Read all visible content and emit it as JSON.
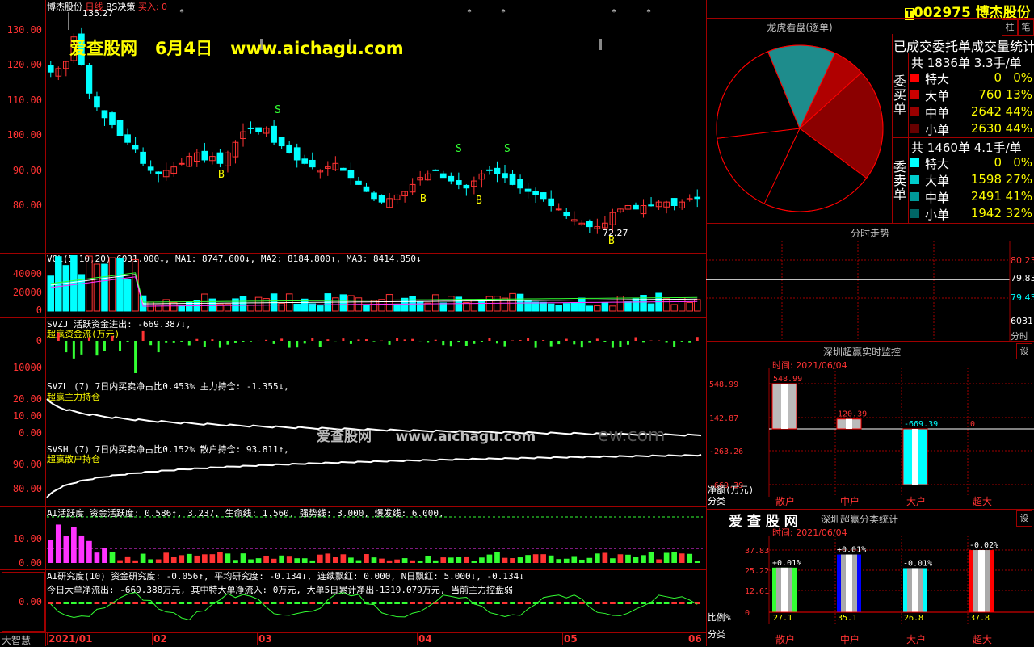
{
  "stock": {
    "code": "002975",
    "name": "博杰股份",
    "marker": "T",
    "header_left_name": "博杰股份",
    "period": "日线",
    "strategy": "BS决策",
    "buy_label": "买入: 0"
  },
  "watermark": {
    "banner": "爱查股网   6月4日   www.aichagu.com",
    "center": "爱查股网     www.aichagu.com",
    "ghost": "ew.com"
  },
  "main_chart": {
    "y_ticks": [
      "130.00",
      "120.00",
      "110.00",
      "100.00",
      "90.00",
      "80.00"
    ],
    "high_label": "135.27",
    "low_label": "72.27",
    "signals": [
      "S",
      "S",
      "S",
      "B",
      "B",
      "B",
      "B"
    ]
  },
  "vol": {
    "title": "VOL(5,10,20) 6031.000↓, MA1: 8747.600↓, MA2: 8184.800↑, MA3: 8414.850↓",
    "y_ticks": [
      "40000",
      "20000",
      "0"
    ]
  },
  "svzj": {
    "title": "SVZJ  活跃资金进出: -669.387↓,",
    "subtitle": "超赢资金流(万元)",
    "y_ticks": [
      "0",
      "-10000"
    ]
  },
  "svzl": {
    "title": "SVZL (7) 7日内买卖净占比0.453% 主力持仓: -1.355↓,",
    "subtitle": "超赢主力持仓",
    "y_ticks": [
      "20.00",
      "10.00",
      "0.00"
    ]
  },
  "svsh": {
    "title": "SVSH (7) 7日内买卖净占比0.152% 散户持仓: 93.811↑,",
    "subtitle": "超赢散户持仓",
    "y_ticks": [
      "90.00",
      "80.00"
    ]
  },
  "ai_active": {
    "title": "AI活跃度  资金活跃度: 0.586↑, 3.237, 生命线: 1.560, 强势线: 3.000, 爆发线: 6.000,",
    "y_ticks": [
      "10.00",
      "0.00"
    ]
  },
  "ai_research": {
    "title": "AI研究度(10)  资金研究度: -0.056↑, 平均研究度: -0.134↓, 连续飘红: 0.000, N日飘红: 5.000↓, -0.134↓",
    "line2": "今日大单净流出: -669.388万元, 其中特大单净流入: 0万元, 大单5日累计净出-1319.079万元, 当前主力控盘弱",
    "y_ticks": [
      "0.00"
    ]
  },
  "x_axis": {
    "labels": [
      "2021/01",
      "02",
      "03",
      "04",
      "05",
      "06"
    ]
  },
  "bottom_left": "大智慧",
  "tabs": {
    "col": "柱",
    "pen": "笔"
  },
  "dragon": {
    "title": "龙虎看盘(逐单)",
    "stat_title": "已成交委托单成交量统计",
    "buy": {
      "label": "委买单",
      "total": "共 1836单 3.3手/单",
      "rows": [
        {
          "name": "特大",
          "count": "0",
          "pct": "0%",
          "color": "#ff0000"
        },
        {
          "name": "大单",
          "count": "760",
          "pct": "13%",
          "color": "#cc0000"
        },
        {
          "name": "中单",
          "count": "2642",
          "pct": "44%",
          "color": "#990000"
        },
        {
          "name": "小单",
          "count": "2630",
          "pct": "44%",
          "color": "#660000"
        }
      ]
    },
    "sell": {
      "label": "委卖单",
      "total": "共 1460单 4.1手/单",
      "rows": [
        {
          "name": "特大",
          "count": "0",
          "pct": "0%",
          "color": "#00ffff"
        },
        {
          "name": "大单",
          "count": "1598",
          "pct": "27%",
          "color": "#00cccc"
        },
        {
          "name": "中单",
          "count": "2491",
          "pct": "41%",
          "color": "#009999"
        },
        {
          "name": "小单",
          "count": "1942",
          "pct": "32%",
          "color": "#006666"
        }
      ]
    }
  },
  "intraday": {
    "title": "分时走势",
    "y_ticks": [
      "80.23",
      "79.83",
      "79.43",
      "6031"
    ],
    "unit": "分时"
  },
  "monitor": {
    "title": "深圳超赢实时监控",
    "time": "时间: 2021/06/04",
    "y_ticks": [
      "548.99",
      "142.87",
      "-263.26",
      "-669.39"
    ],
    "values": [
      548.99,
      120.39,
      -669.39,
      0
    ],
    "value_labels": [
      "548.99",
      "120.39",
      "-669.39",
      "0"
    ],
    "categories": [
      "散户",
      "中户",
      "大户",
      "超大"
    ],
    "ylabel": "净额(万元)",
    "xlabel": "分类",
    "set": "设"
  },
  "classify": {
    "brand": "爱 查 股 网",
    "title": "深圳超赢分类统计",
    "time": "时间: 2021/06/04",
    "y_ticks": [
      "37.83",
      "25.22",
      "12.61",
      "0"
    ],
    "values": [
      27.1,
      35.1,
      26.8,
      37.8
    ],
    "value_labels": [
      "27.1",
      "35.1",
      "26.8",
      "37.8"
    ],
    "change_labels": [
      "+0.01%",
      "+0.01%",
      "-0.01%",
      "-0.02%"
    ],
    "categories": [
      "散户",
      "中户",
      "大户",
      "超大"
    ],
    "ylabel": "比例%",
    "xlabel": "分类",
    "set": "设"
  },
  "colors": {
    "up": "#ff3333",
    "down": "#00ffff",
    "frame": "#a00000"
  }
}
